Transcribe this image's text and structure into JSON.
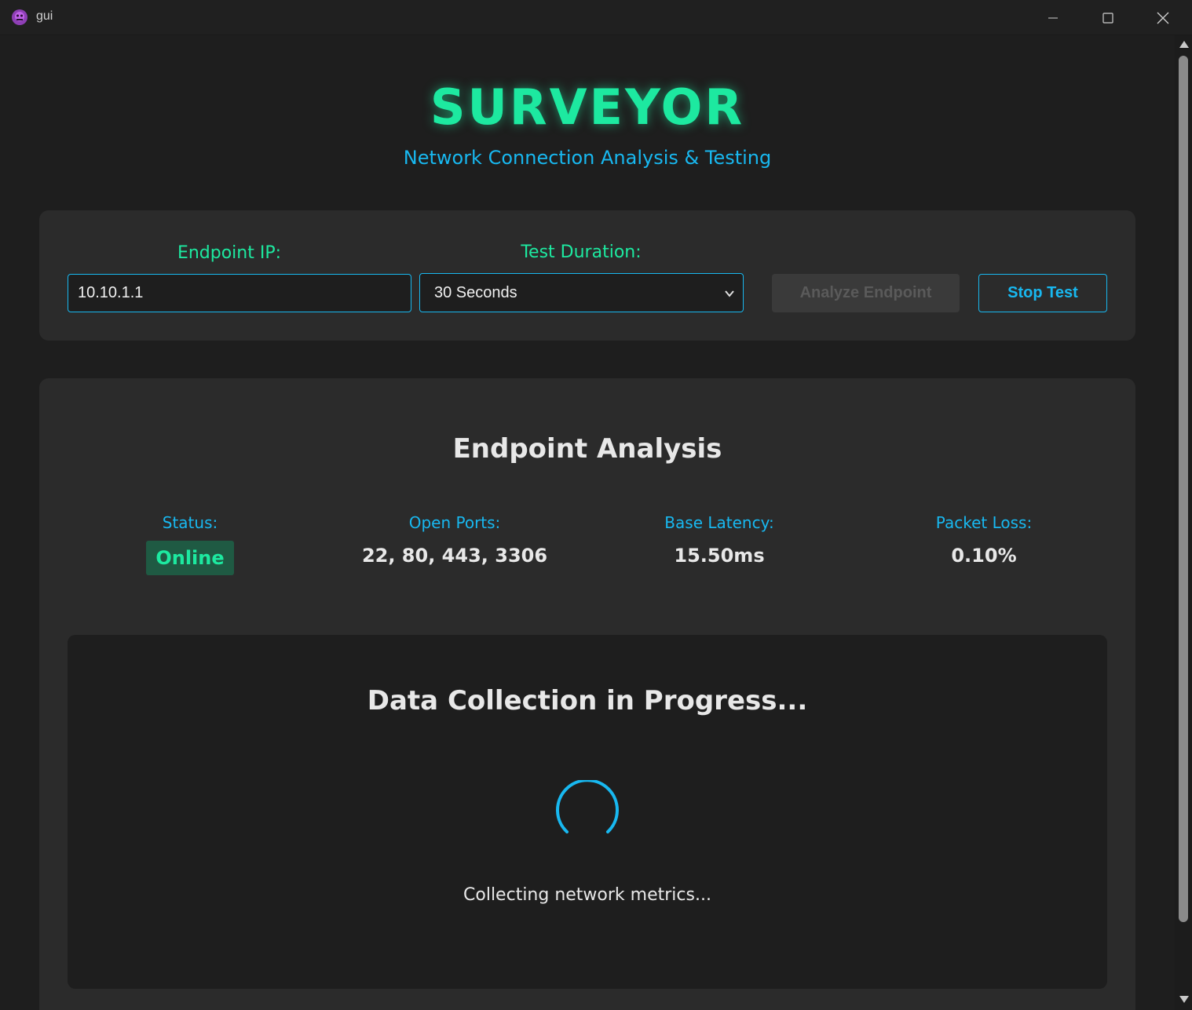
{
  "window": {
    "title": "gui",
    "icon": "app-logo-icon",
    "controls": {
      "minimize": "minimize-icon",
      "maximize": "maximize-icon",
      "close": "close-icon"
    }
  },
  "header": {
    "title": "SURVEYOR",
    "subtitle": "Network Connection Analysis & Testing"
  },
  "controls": {
    "endpoint_label": "Endpoint IP:",
    "endpoint_value": "10.10.1.1",
    "duration_label": "Test Duration:",
    "duration_selected": "30 Seconds",
    "analyze_button": "Analyze Endpoint",
    "analyze_disabled": true,
    "stop_button": "Stop Test"
  },
  "analysis": {
    "title": "Endpoint Analysis",
    "metrics": {
      "status_label": "Status:",
      "status_value": "Online",
      "ports_label": "Open Ports:",
      "ports_value": "22, 80, 443, 3306",
      "latency_label": "Base Latency:",
      "latency_value": "15.50ms",
      "loss_label": "Packet Loss:",
      "loss_value": "0.10%"
    },
    "progress": {
      "title": "Data Collection in Progress...",
      "message": "Collecting network metrics...",
      "spinner_icon": "loading-spinner-icon"
    }
  },
  "colors": {
    "accent_green": "#1de9a0",
    "accent_blue": "#18b8f0",
    "background": "#1e1e1e",
    "card": "#2b2b2b"
  }
}
